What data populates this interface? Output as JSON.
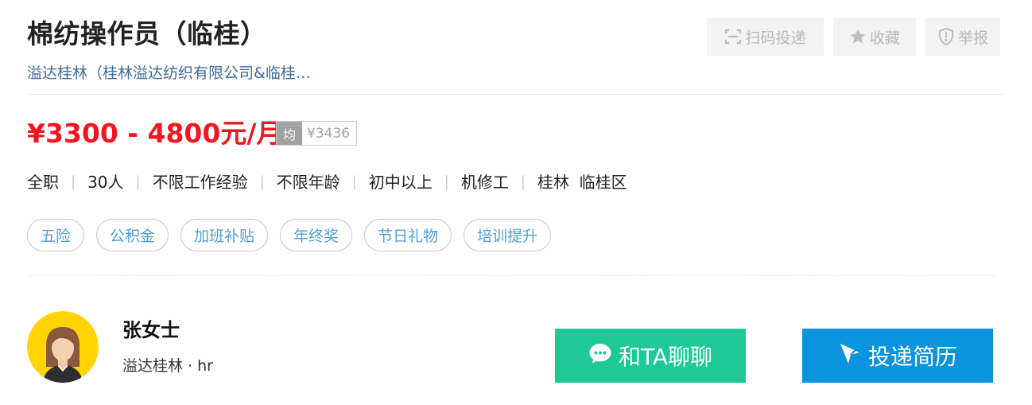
{
  "job": {
    "title": "棉纺操作员（临桂）",
    "company_link": "溢达桂林（桂林溢达纺织有限公司&临桂…"
  },
  "actions": {
    "scan_apply": "扫码投递",
    "favorite": "收藏",
    "report": "举报"
  },
  "salary": {
    "range": "¥3300 - 4800元/月",
    "avg_label": "均",
    "avg_value": "¥3436"
  },
  "meta": [
    "全职",
    "30人",
    "不限工作经验",
    "不限年龄",
    "初中以上",
    "机修工",
    "桂林  临桂区"
  ],
  "meta_separator": "|",
  "tags": [
    "五险",
    "公积金",
    "加班补贴",
    "年终奖",
    "节日礼物",
    "培训提升"
  ],
  "recruiter": {
    "name": "张女士",
    "company": "溢达桂林 · hr"
  },
  "buttons": {
    "chat": "和TA聊聊",
    "apply": "投递简历"
  },
  "colors": {
    "salary": "#f5141e",
    "chat_button": "#1ec996",
    "apply_button": "#0994dd",
    "tag_text": "#4f9fd6",
    "company_link": "#3e6a9e",
    "avatar_bg": "#ffd400"
  },
  "icons": {
    "scan": "scan-icon",
    "favorite": "star-icon",
    "report": "shield-alert-icon",
    "chat": "chat-bubble-icon",
    "apply": "paper-plane-icon",
    "avatar": "female-avatar"
  }
}
